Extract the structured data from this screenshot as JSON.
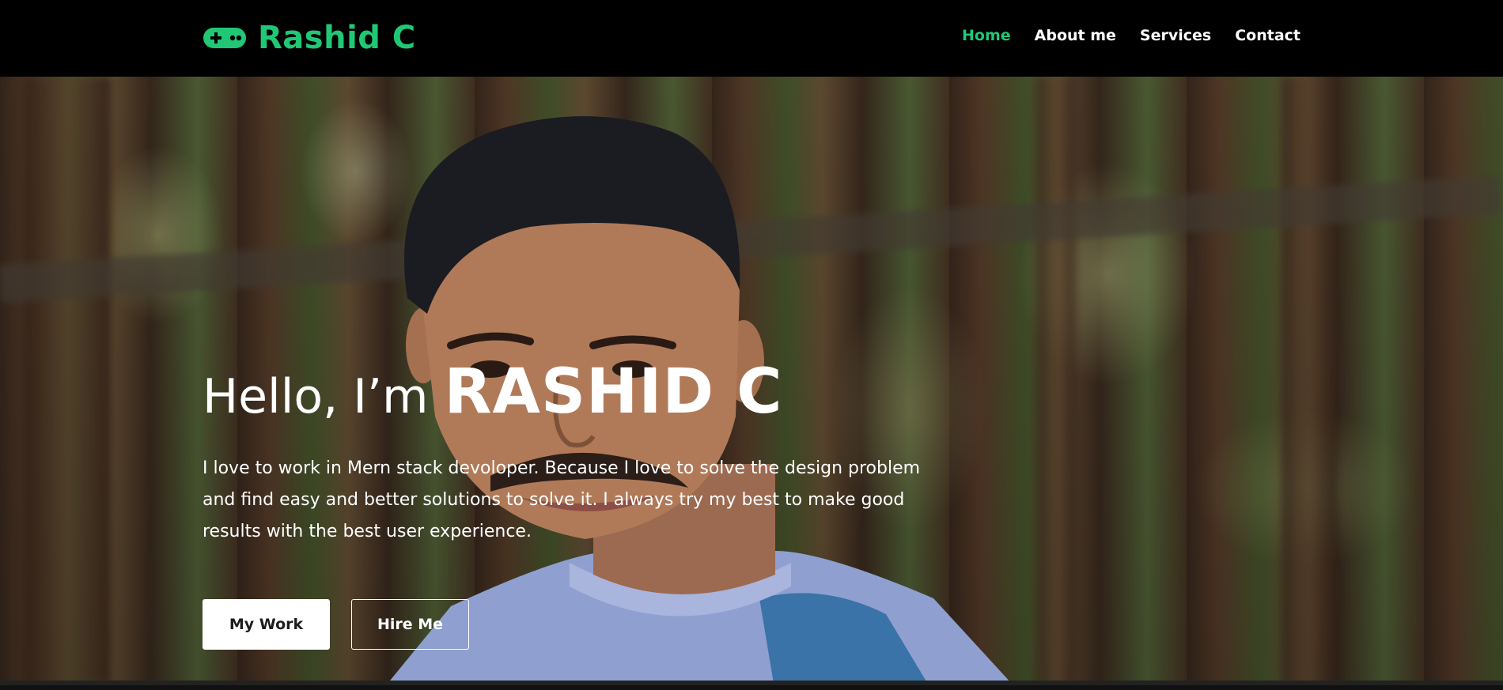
{
  "brand": {
    "icon": "gamepad-icon",
    "name": "Rashid C",
    "color": "#20c875"
  },
  "nav": {
    "items": [
      {
        "label": "Home",
        "active": true
      },
      {
        "label": "About me",
        "active": false
      },
      {
        "label": "Services",
        "active": false
      },
      {
        "label": "Contact",
        "active": false
      }
    ]
  },
  "hero": {
    "greeting": "Hello, I’m",
    "name": "RASHID C",
    "description": "I love to work in Mern stack devoloper. Because I love to solve the design problem and find easy and better solutions to solve it. I always try my best to make good results with the best user experience.",
    "buttons": {
      "primary": "My Work",
      "secondary": "Hire Me"
    }
  },
  "colors": {
    "accent": "#20c875",
    "navbar_bg": "#000000",
    "text": "#ffffff"
  }
}
